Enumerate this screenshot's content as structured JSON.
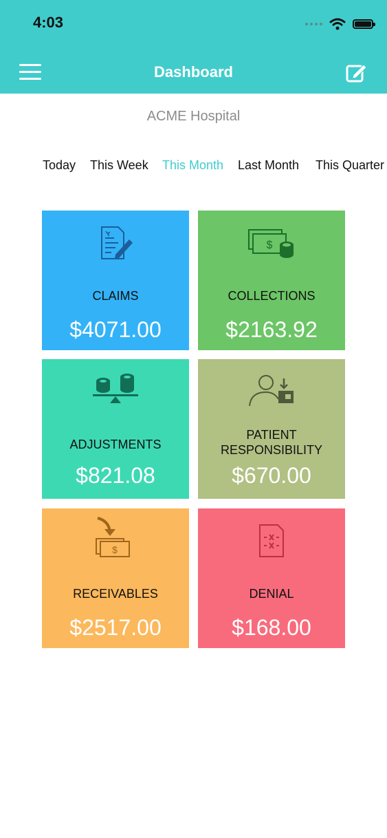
{
  "status_bar": {
    "time": "4:03"
  },
  "header": {
    "title": "Dashboard"
  },
  "organization": "ACME Hospital",
  "tabs": [
    {
      "label": "Today",
      "active": false
    },
    {
      "label": "This Week",
      "active": false
    },
    {
      "label": "This Month",
      "active": true
    },
    {
      "label": "Last Month",
      "active": false
    },
    {
      "label": "This Quarter",
      "active": false
    }
  ],
  "tiles": [
    {
      "label": "CLAIMS",
      "value": "$4071.00",
      "color": "#33b2f8",
      "icon": "document-pen-icon"
    },
    {
      "label": "COLLECTIONS",
      "value": "$2163.92",
      "color": "#6cc566",
      "icon": "cash-coins-icon"
    },
    {
      "label": "ADJUSTMENTS",
      "value": "$821.08",
      "color": "#3dd9b3",
      "icon": "balance-coins-icon"
    },
    {
      "label": "PATIENT RESPONSIBILITY",
      "value": "$670.00",
      "color": "#b1c083",
      "icon": "patient-wallet-icon"
    },
    {
      "label": "RECEIVABLES",
      "value": "$2517.00",
      "color": "#fbb85c",
      "icon": "incoming-cash-icon"
    },
    {
      "label": "DENIAL",
      "value": "$168.00",
      "color": "#f86b7c",
      "icon": "denied-document-icon"
    }
  ]
}
